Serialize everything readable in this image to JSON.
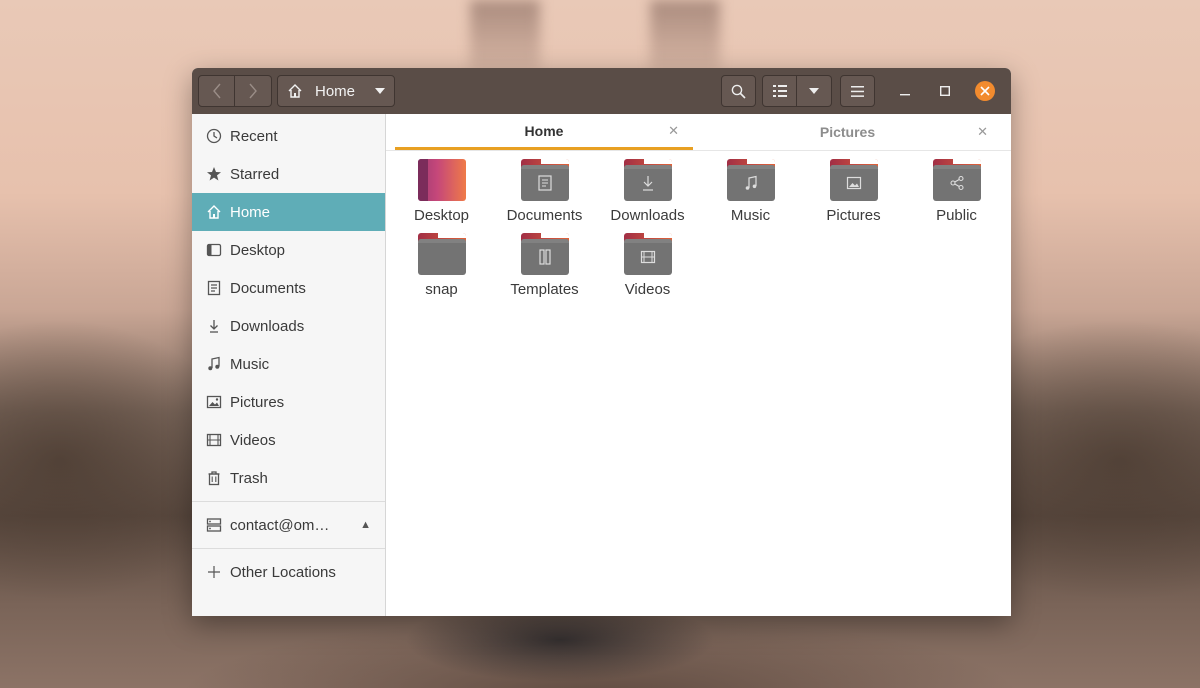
{
  "window": {
    "path_label": "Home"
  },
  "tabs": [
    {
      "label": "Home",
      "active": true
    },
    {
      "label": "Pictures",
      "active": false
    }
  ],
  "sidebar": {
    "items": [
      {
        "label": "Recent",
        "icon": "clock-icon"
      },
      {
        "label": "Starred",
        "icon": "star-icon"
      },
      {
        "label": "Home",
        "icon": "home-icon",
        "active": true
      },
      {
        "label": "Desktop",
        "icon": "desktop-icon"
      },
      {
        "label": "Documents",
        "icon": "document-icon"
      },
      {
        "label": "Downloads",
        "icon": "download-icon"
      },
      {
        "label": "Music",
        "icon": "music-icon"
      },
      {
        "label": "Pictures",
        "icon": "picture-icon"
      },
      {
        "label": "Videos",
        "icon": "video-icon"
      },
      {
        "label": "Trash",
        "icon": "trash-icon"
      }
    ],
    "mount": {
      "label": "contact@om…",
      "icon": "network-drive-icon"
    },
    "other_locations": {
      "label": "Other Locations",
      "icon": "plus-icon"
    }
  },
  "files": [
    {
      "name": "Desktop",
      "icon": "desktop-folder-icon"
    },
    {
      "name": "Documents",
      "icon": "documents-folder-icon"
    },
    {
      "name": "Downloads",
      "icon": "downloads-folder-icon"
    },
    {
      "name": "Music",
      "icon": "music-folder-icon"
    },
    {
      "name": "Pictures",
      "icon": "pictures-folder-icon"
    },
    {
      "name": "Public",
      "icon": "public-folder-icon"
    },
    {
      "name": "snap",
      "icon": "folder-icon"
    },
    {
      "name": "Templates",
      "icon": "templates-folder-icon"
    },
    {
      "name": "Videos",
      "icon": "videos-folder-icon"
    }
  ],
  "colors": {
    "headerbar": "#5a4d47",
    "sidebar_active": "#5fadb7",
    "tab_underline": "#e8a022",
    "close_button": "#f28b2e",
    "folder_tab_gradient": [
      "#a12e45",
      "#e0633a"
    ],
    "folder_body": "#737373"
  }
}
